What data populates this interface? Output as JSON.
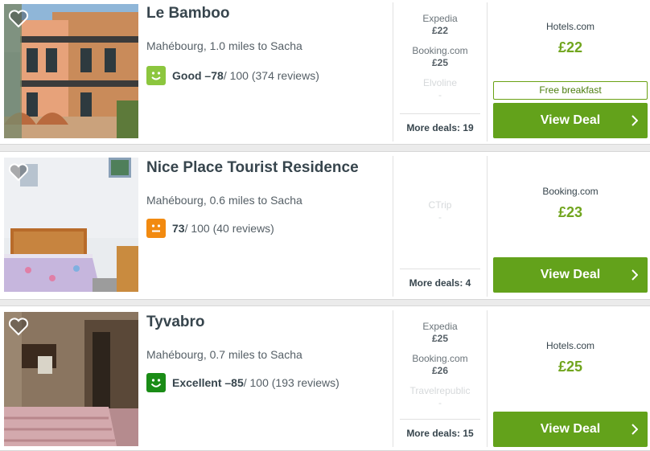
{
  "colors": {
    "accent_green": "#63a21b",
    "price_green": "#71a51e",
    "rating_good": "#8cc63e",
    "rating_okay": "#f28a10",
    "rating_excellent": "#1a8c16"
  },
  "hotels": [
    {
      "name": "Le Bamboo",
      "location": "Mahébourg, 1.0 miles to Sacha",
      "rating": {
        "icon": "smiley-good-icon",
        "label": "Good – ",
        "score": "78",
        "rest": " / 100 (374 reviews)"
      },
      "deals": [
        {
          "site": "Expedia",
          "price": "£22"
        },
        {
          "site": "Booking.com",
          "price": "£25"
        },
        {
          "site": "Elvoline",
          "price": "-"
        }
      ],
      "more_deals": "More deals: 19",
      "best": {
        "site": "Hotels.com",
        "price": "£22",
        "extra": "Free breakfast"
      },
      "view_deal": "View Deal"
    },
    {
      "name": "Nice Place Tourist Residence",
      "location": "Mahébourg, 0.6 miles to Sacha",
      "rating": {
        "icon": "smiley-okay-icon",
        "label": "",
        "score": "73",
        "rest": " / 100 (40 reviews)"
      },
      "deals": [
        {
          "site": "CTrip",
          "price": "-"
        }
      ],
      "more_deals": "More deals: 4",
      "best": {
        "site": "Booking.com",
        "price": "£23"
      },
      "view_deal": "View Deal"
    },
    {
      "name": "Tyvabro",
      "location": "Mahébourg, 0.7 miles to Sacha",
      "rating": {
        "icon": "smiley-excellent-icon",
        "label": "Excellent – ",
        "score": "85",
        "rest": " / 100 (193 reviews)"
      },
      "deals": [
        {
          "site": "Expedia",
          "price": "£25"
        },
        {
          "site": "Booking.com",
          "price": "£26"
        },
        {
          "site": "Travelrepublic",
          "price": "-"
        }
      ],
      "more_deals": "More deals: 15",
      "best": {
        "site": "Hotels.com",
        "price": "£25"
      },
      "view_deal": "View Deal"
    }
  ]
}
